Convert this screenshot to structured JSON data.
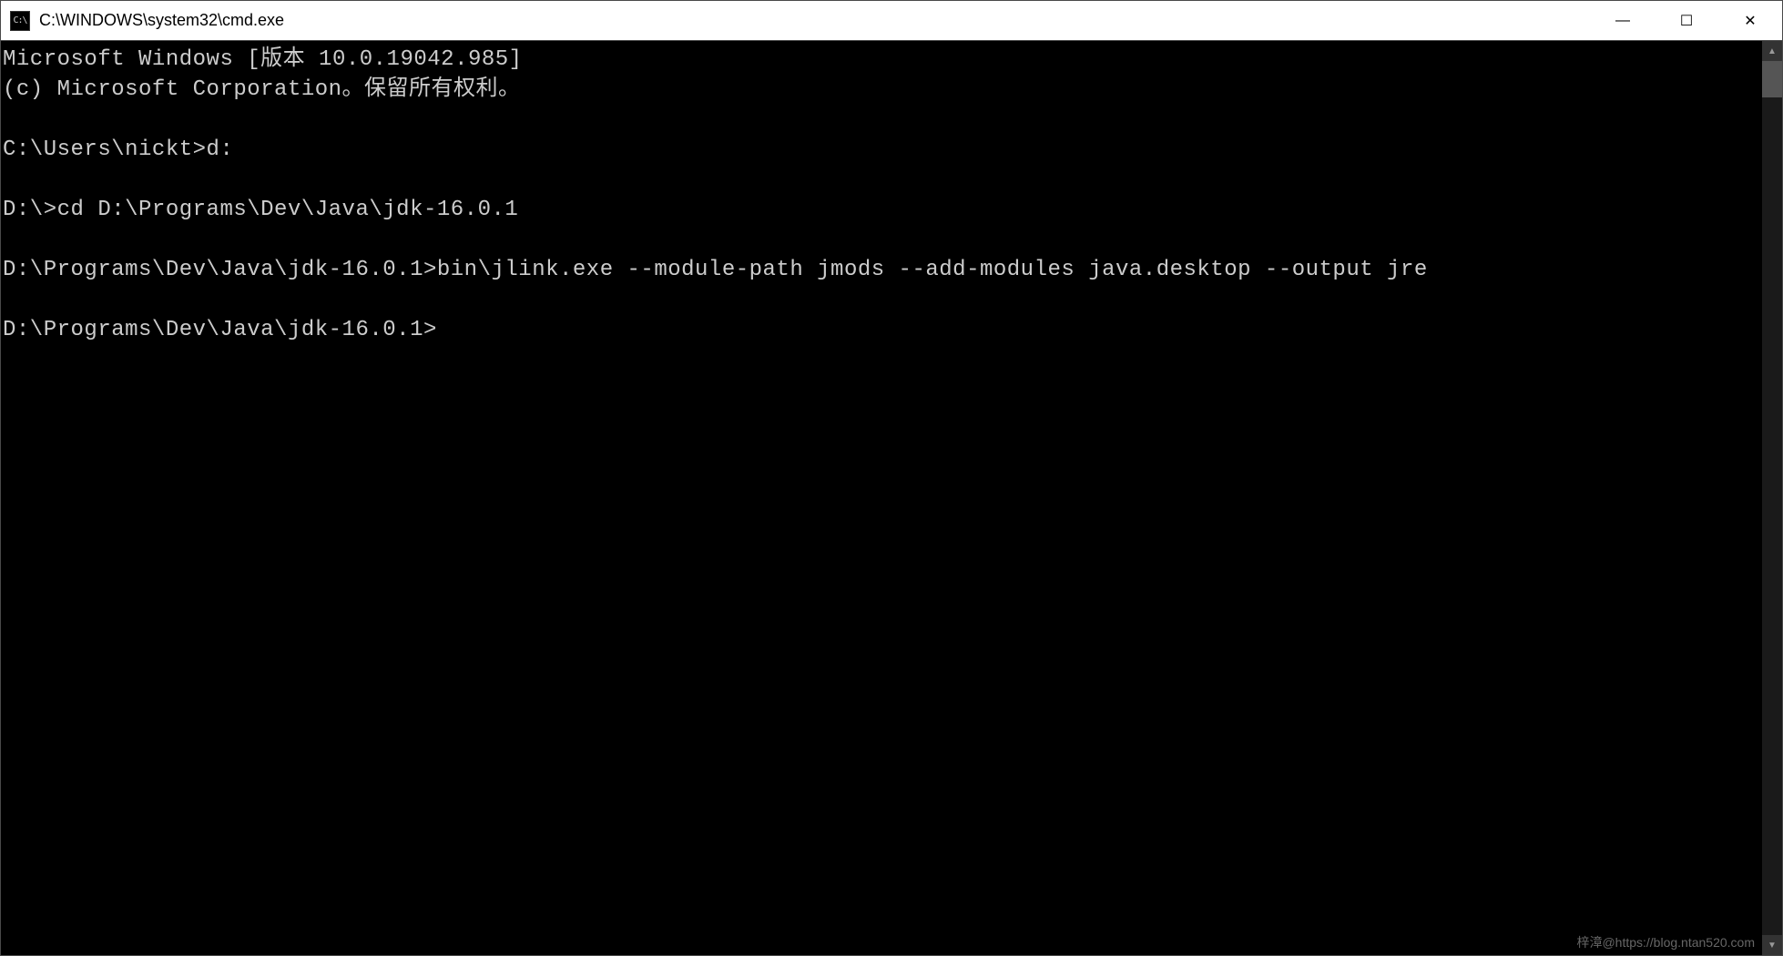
{
  "window": {
    "title": "C:\\WINDOWS\\system32\\cmd.exe",
    "icon_label": "cmd-icon",
    "icon_text": "C:\\"
  },
  "controls": {
    "minimize_glyph": "—",
    "maximize_glyph": "☐",
    "close_glyph": "✕"
  },
  "terminal": {
    "lines": [
      "Microsoft Windows [版本 10.0.19042.985]",
      "(c) Microsoft Corporation。保留所有权利。",
      "",
      "C:\\Users\\nickt>d:",
      "",
      "D:\\>cd D:\\Programs\\Dev\\Java\\jdk-16.0.1",
      "",
      "D:\\Programs\\Dev\\Java\\jdk-16.0.1>bin\\jlink.exe --module-path jmods --add-modules java.desktop --output jre",
      "",
      "D:\\Programs\\Dev\\Java\\jdk-16.0.1>"
    ]
  },
  "watermark": "梓漳@https://blog.ntan520.com"
}
